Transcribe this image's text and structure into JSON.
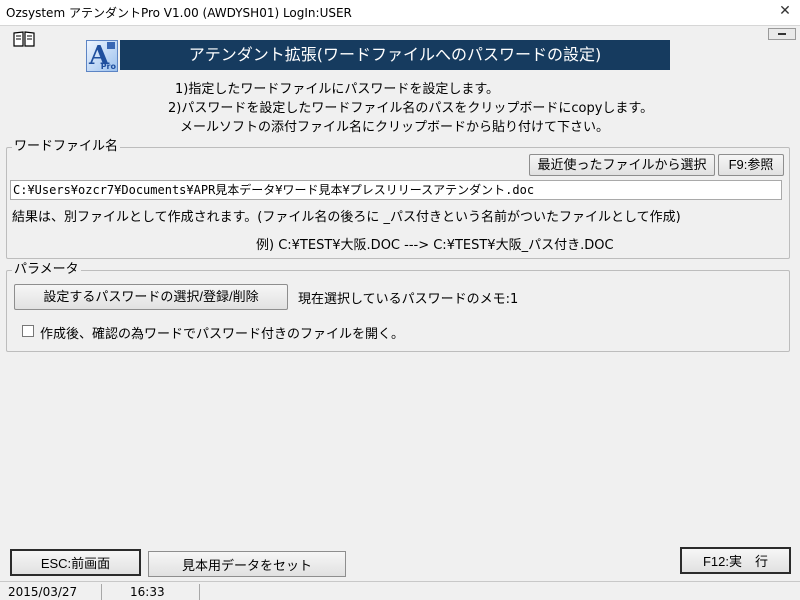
{
  "window": {
    "title": "Ozsystem アテンダントPro V1.00 (AWDYSH01)  LogIn:USER",
    "close_glyph": "✕"
  },
  "header": {
    "banner_title": "アテンダント拡張(ワードファイルへのパスワードの設定)",
    "logo_letter": "A",
    "logo_sub": "Pro",
    "description": [
      "1)指定したワードファイルにパスワードを設定します。",
      "2)パスワードを設定したワードファイル名のパスをクリップボードにcopyします。",
      "メールソフトの添付ファイル名にクリップボードから貼り付けて下さい。"
    ]
  },
  "word_file": {
    "group_label": "ワードファイル名",
    "recent_button": "最近使ったファイルから選択",
    "browse_button": "F9:参照",
    "path_value": "C:¥Users¥ozcr7¥Documents¥APR見本データ¥ワード見本¥プレスリリースアテンダント.doc",
    "note": "結果は、別ファイルとして作成されます。(ファイル名の後ろに _パス付きという名前がついたファイルとして作成)",
    "example": "例) C:¥TEST¥大阪.DOC   --->   C:¥TEST¥大阪_パス付き.DOC"
  },
  "params": {
    "group_label": "パラメータ",
    "select_button": "設定するパスワードの選択/登録/削除",
    "current_memo": "現在選択しているパスワードのメモ:1",
    "open_checkbox_label": "作成後、確認の為ワードでパスワード付きのファイルを開く。",
    "open_checked": false
  },
  "footer": {
    "esc_button": "ESC:前画面",
    "sample_button": "見本用データをセット",
    "run_button": "F12:実　行"
  },
  "status": {
    "date": "2015/03/27",
    "time": "16:33"
  },
  "colors": {
    "banner_bg": "#163b5f",
    "window_bg": "#f0f0f0"
  }
}
